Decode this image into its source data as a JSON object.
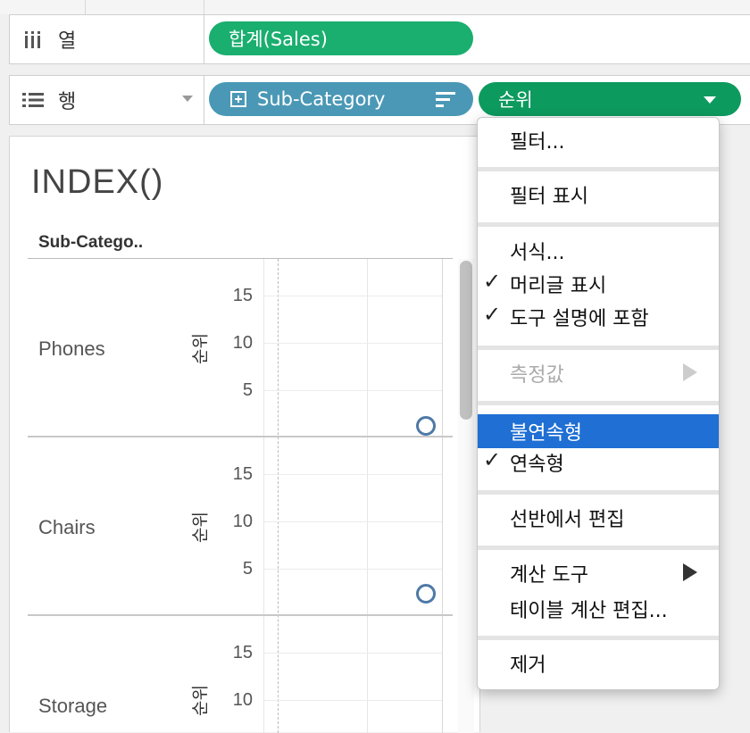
{
  "shelves": {
    "columns": {
      "label": "열",
      "icon": "columns-icon",
      "pills": [
        "합계(Sales)"
      ]
    },
    "rows": {
      "label": "행",
      "icon": "rows-icon",
      "pills": [
        "Sub-Category",
        "순위"
      ]
    }
  },
  "colors": {
    "green": "#1aae6f",
    "darkgreen": "#0d9a5e",
    "blue": "#4a98b6",
    "highlight": "#1f6fd4",
    "mark": "#4e79a7"
  },
  "view": {
    "title": "INDEX()",
    "column_header": "Sub-Catego..",
    "axis_title": "순위",
    "ticks": [
      "15",
      "10",
      "5"
    ],
    "rows": [
      {
        "label": "Phones",
        "rank": 1
      },
      {
        "label": "Chairs",
        "rank": 2
      },
      {
        "label": "Storage"
      }
    ]
  },
  "context_menu": {
    "items": [
      {
        "label": "필터...",
        "checked": false,
        "disabled": false
      },
      {
        "label": "필터 표시",
        "checked": false,
        "disabled": false
      },
      {
        "label": "서식...",
        "checked": false,
        "disabled": false
      },
      {
        "label": "머리글 표시",
        "checked": true,
        "disabled": false
      },
      {
        "label": "도구 설명에 포함",
        "checked": true,
        "disabled": false
      },
      {
        "label": "측정값",
        "checked": false,
        "disabled": true,
        "submenu": true
      },
      {
        "label": "불연속형",
        "checked": false,
        "disabled": false,
        "highlighted": true
      },
      {
        "label": "연속형",
        "checked": true,
        "disabled": false
      },
      {
        "label": "선반에서 편집",
        "checked": false,
        "disabled": false
      },
      {
        "label": "계산 도구",
        "checked": false,
        "disabled": false,
        "submenu": true
      },
      {
        "label": "테이블 계산 편집...",
        "checked": false,
        "disabled": false
      },
      {
        "label": "제거",
        "checked": false,
        "disabled": false
      }
    ],
    "check_glyph": "✓"
  }
}
